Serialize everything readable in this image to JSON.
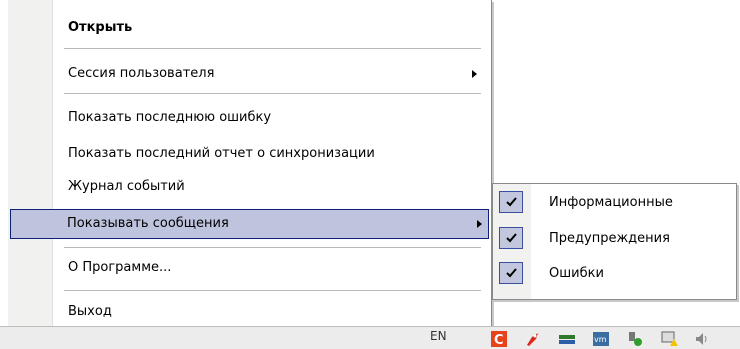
{
  "context_menu": {
    "items": [
      {
        "label": "Открыть"
      },
      {
        "label": "Сессия пользователя"
      },
      {
        "label": "Показать последнюю ошибку"
      },
      {
        "label": "Показать последний отчет о синхронизации"
      },
      {
        "label": "Журнал событий"
      },
      {
        "label": "Показывать сообщения"
      },
      {
        "label": "О Программе..."
      },
      {
        "label": "Выход"
      }
    ]
  },
  "submenu": {
    "items": [
      {
        "label": "Информационные",
        "checked": true
      },
      {
        "label": "Предупреждения",
        "checked": true
      },
      {
        "label": "Ошибки",
        "checked": true
      }
    ]
  },
  "taskbar": {
    "language": "EN",
    "tray_icons": [
      "app-c-icon",
      "rocket-icon",
      "network-card-icon",
      "vmware-icon",
      "usb-safe-remove-icon",
      "network-warning-icon",
      "volume-icon"
    ]
  },
  "colors": {
    "highlight_fill": "#bfc4de",
    "highlight_border": "#0f1f7a",
    "gutter": "#f1f1ef"
  }
}
